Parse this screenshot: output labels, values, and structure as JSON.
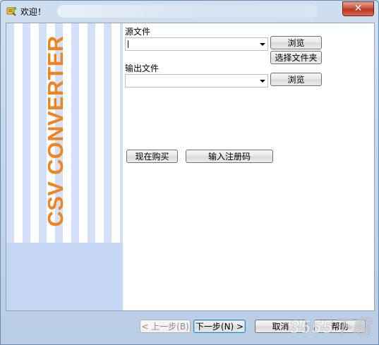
{
  "window": {
    "title": "欢迎！",
    "close_symbol": "✕"
  },
  "banner": {
    "text": "CSV CONVERTER",
    "color": "#ef8421"
  },
  "source": {
    "label": "源文件",
    "value": "",
    "browse_label": "浏览",
    "choose_folder_label": "选择文件夹"
  },
  "output": {
    "label": "输出文件",
    "value": "",
    "browse_label": "浏览"
  },
  "purchase": {
    "buy_label": "现在购买",
    "register_label": "输入注册码"
  },
  "footer": {
    "back_label": "< 上一步(B)",
    "next_label": "下一步(N) >",
    "cancel_label": "取消",
    "help_label": "帮助"
  },
  "watermark": "3555下载"
}
